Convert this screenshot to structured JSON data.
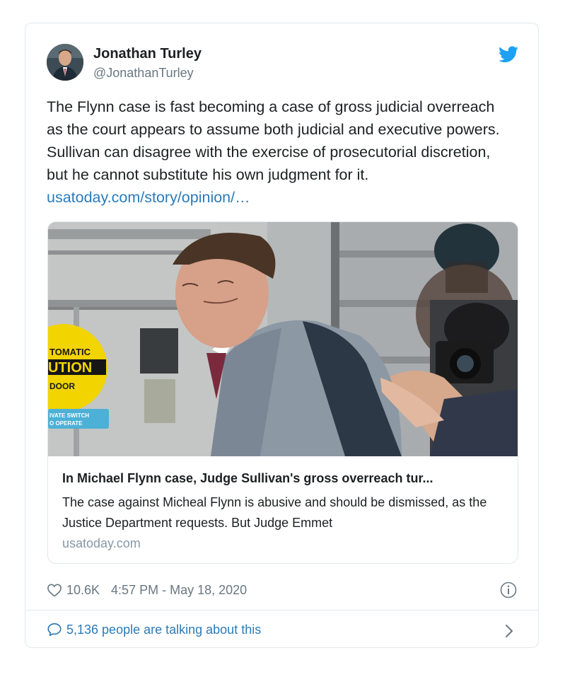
{
  "author": {
    "name": "Jonathan Turley",
    "handle": "@JonathanTurley"
  },
  "tweet": {
    "text": "The Flynn case is fast becoming a case of gross judicial overreach as the court appears to assume both judicial and executive powers. Sullivan can disagree with the exercise of prosecutorial discretion, but he cannot substitute his own judgment for it.",
    "link_text": "usatoday.com/story/opinion/…"
  },
  "card": {
    "title": "In Michael Flynn case, Judge Sullivan's gross overreach tur...",
    "description": "The case against Micheal Flynn is abusive and should be dismissed, as the Justice Department requests. But Judge Emmet",
    "domain": "usatoday.com",
    "sign_lines": [
      "TOMATIC",
      "UTION",
      "DOOR"
    ],
    "switch_label_lines": [
      "IVATE SWITCH",
      "O OPERATE"
    ]
  },
  "meta": {
    "likes": "10.6K",
    "timestamp": "4:57 PM - May 18, 2020"
  },
  "footer": {
    "talking": "5,136 people are talking about this"
  },
  "colors": {
    "link_blue": "#2b7bb9",
    "twitter_blue": "#1da1f2",
    "muted_gray": "#697882",
    "border": "#e1e8ed"
  },
  "icons": [
    "twitter-bird-icon",
    "heart-icon",
    "info-icon",
    "speech-bubble-icon",
    "chevron-right-icon"
  ]
}
